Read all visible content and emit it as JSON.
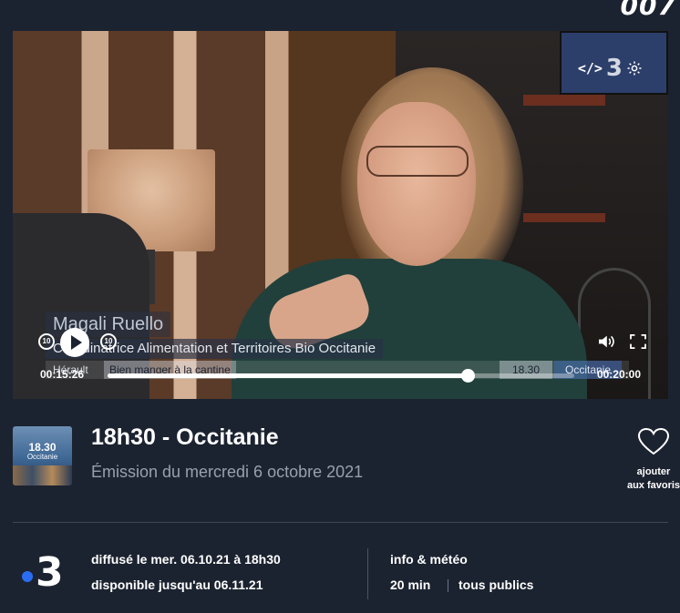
{
  "header": {
    "partial_logo": "007"
  },
  "player": {
    "lower_third": {
      "name": "Magali Ruello",
      "role": "Coordinatrice Alimentation et Territoires Bio Occitanie",
      "ticker_left": "Hérault",
      "ticker_tag": "Bien manger à la cantine",
      "ticker_time": "18.30",
      "ticker_region": "Occitanie"
    },
    "watermark": "3",
    "embed_icon_label": "</>",
    "time_elapsed": "00:15:26",
    "time_total": "00:20:00",
    "progress_fraction": 0.772,
    "skip_back_label": "10",
    "skip_forward_label": "10"
  },
  "program": {
    "thumb_title": "18.30",
    "thumb_subtitle": "Occitanie",
    "title": "18h30 - Occitanie",
    "subtitle": "Émission du mercredi 6 octobre 2021",
    "favorite_line1": "ajouter",
    "favorite_line2": "aux favoris"
  },
  "meta": {
    "channel_number": "3",
    "broadcast": "diffusé le mer. 06.10.21 à 18h30",
    "available": "disponible jusqu'au 06.11.21",
    "category": "info & météo",
    "duration": "20 min",
    "audience": "tous publics"
  },
  "colors": {
    "background": "#1c2330",
    "accent_blue": "#2a6df4",
    "muted_text": "#98a0ae"
  }
}
